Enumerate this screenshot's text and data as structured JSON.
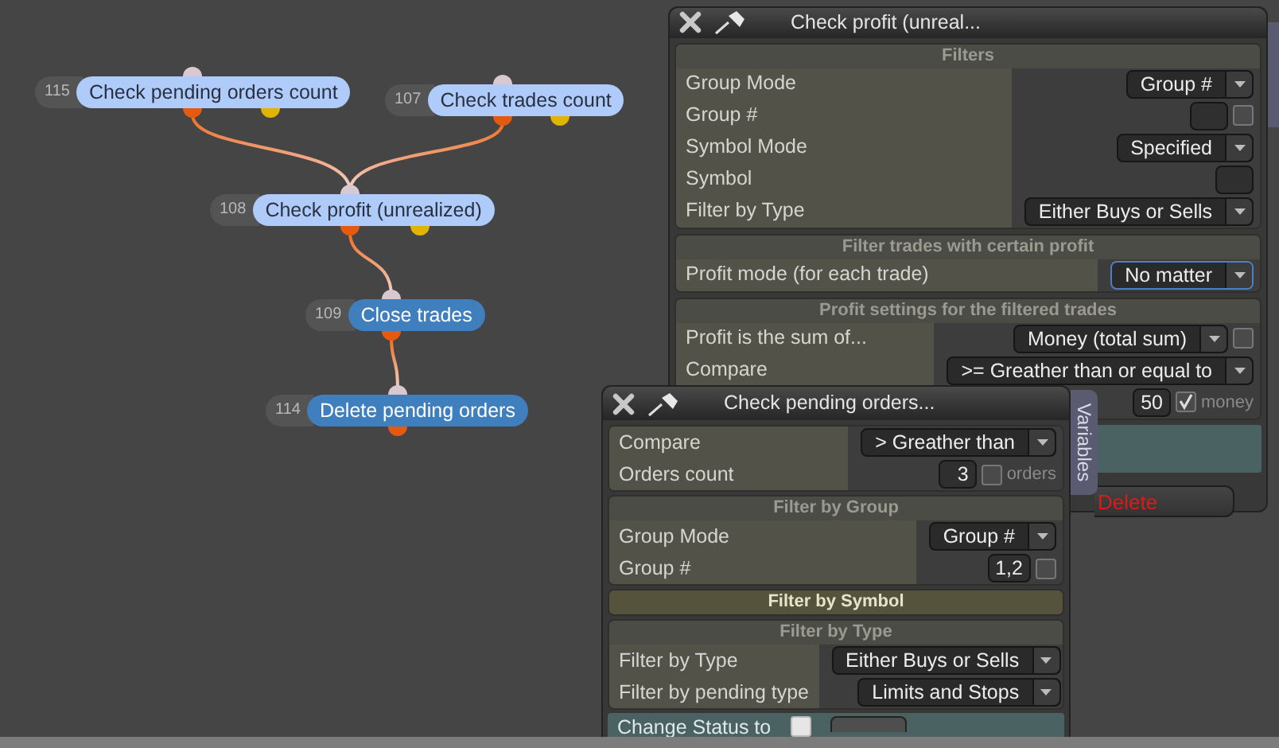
{
  "graph": {
    "nodes": [
      {
        "number": "115",
        "label": "Check pending orders count",
        "kind": "condition"
      },
      {
        "number": "107",
        "label": "Check trades count",
        "kind": "condition"
      },
      {
        "number": "108",
        "label": "Check profit (unrealized)",
        "kind": "condition"
      },
      {
        "number": "109",
        "label": "Close trades",
        "kind": "action"
      },
      {
        "number": "114",
        "label": "Delete pending orders",
        "kind": "action"
      }
    ]
  },
  "profit_window": {
    "title": "Check profit (unreal...",
    "sections": [
      {
        "title": "Filters",
        "expanded": true,
        "rows": [
          {
            "label": "Group Mode",
            "kind": "select",
            "value": "Group #"
          },
          {
            "label": "Group #",
            "kind": "input",
            "checked": false
          },
          {
            "label": "Symbol Mode",
            "kind": "select",
            "value": "Specified"
          },
          {
            "label": "Symbol",
            "kind": "input"
          },
          {
            "label": "Filter by Type",
            "kind": "select",
            "value": "Either Buys or Sells"
          }
        ]
      },
      {
        "title": "Filter trades with certain profit",
        "expanded": true,
        "rows": [
          {
            "label": "Profit mode (for each trade)",
            "kind": "select",
            "value": "No matter",
            "focused": true
          }
        ]
      },
      {
        "title": "Profit settings for the filtered trades",
        "expanded": true,
        "rows": [
          {
            "label": "Profit is the sum of...",
            "kind": "select",
            "value": "Money (total sum)",
            "checked": false
          },
          {
            "label": "Compare",
            "kind": "select",
            "value": ">= Greather than or equal to"
          },
          {
            "kind": "input",
            "value": "50",
            "checked": true,
            "unit": "money"
          }
        ]
      }
    ],
    "delete_button": "Delete"
  },
  "pending_window": {
    "title": "Check pending orders...",
    "variables_tab": "Variables",
    "sections": [
      {
        "rows": [
          {
            "label": "Compare",
            "kind": "select",
            "value": "> Greather than"
          },
          {
            "label": "Orders count",
            "kind": "input",
            "value": "3",
            "checked": false,
            "unit": "orders"
          }
        ]
      },
      {
        "title": "Filter by Group",
        "expanded": true,
        "rows": [
          {
            "label": "Group Mode",
            "kind": "select",
            "value": "Group #"
          },
          {
            "label": "Group #",
            "kind": "input",
            "value": "1,2",
            "checked": false
          }
        ]
      },
      {
        "title": "Filter by Symbol",
        "expanded": false
      },
      {
        "title": "Filter by Type",
        "expanded": true,
        "rows": [
          {
            "label": "Filter by Type",
            "kind": "select",
            "value": "Either Buys or Sells"
          },
          {
            "label": "Filter by pending type",
            "kind": "select",
            "value": "Limits and Stops"
          }
        ]
      }
    ],
    "status_row": {
      "label": "Change Status to",
      "checked": false
    }
  }
}
